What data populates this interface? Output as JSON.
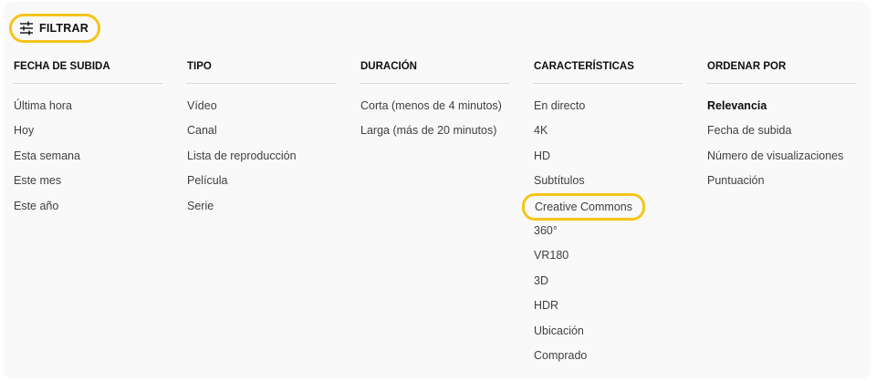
{
  "filter_toggle": {
    "label": "FILTRAR",
    "icon": "sliders-icon"
  },
  "colors": {
    "highlight": "#f5c518",
    "panel_bg": "#f9f9f9",
    "divider": "#d9d9d9"
  },
  "columns": [
    {
      "header": "FECHA DE SUBIDA",
      "options": [
        "Última hora",
        "Hoy",
        "Esta semana",
        "Este mes",
        "Este año"
      ]
    },
    {
      "header": "TIPO",
      "options": [
        "Vídeo",
        "Canal",
        "Lista de reproducción",
        "Película",
        "Serie"
      ]
    },
    {
      "header": "DURACIÓN",
      "options": [
        "Corta (menos de 4 minutos)",
        "Larga (más de 20 minutos)"
      ]
    },
    {
      "header": "CARACTERÍSTICAS",
      "options": [
        "En directo",
        "4K",
        "HD",
        "Subtítulos",
        "Creative Commons",
        "360°",
        "VR180",
        "3D",
        "HDR",
        "Ubicación",
        "Comprado"
      ],
      "highlighted_option": "Creative Commons"
    },
    {
      "header": "ORDENAR POR",
      "options": [
        "Relevancia",
        "Fecha de subida",
        "Número de visualizaciones",
        "Puntuación"
      ],
      "selected_option": "Relevancia"
    }
  ]
}
